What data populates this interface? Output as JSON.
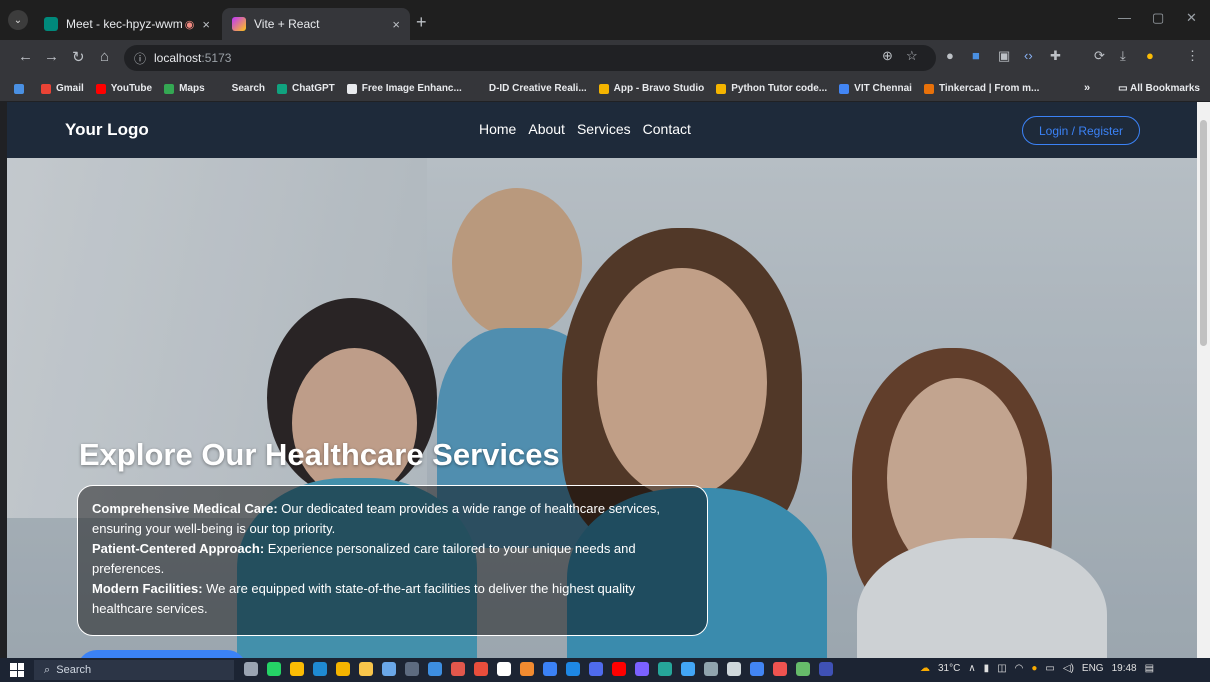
{
  "browser": {
    "tabs": [
      {
        "title": "Meet - kec-hpyz-wwm",
        "recording": "◉",
        "close": "×"
      },
      {
        "title": "Vite + React",
        "close": "×"
      }
    ],
    "new_tab": "+",
    "url_host": "localhost",
    "url_port": ":5173",
    "bookmarks": [
      {
        "label": "Gmail",
        "color": "#ea4335"
      },
      {
        "label": "YouTube",
        "color": "#ff0000"
      },
      {
        "label": "Maps",
        "color": "#34a853"
      },
      {
        "label": "Search",
        "color": "#35363a"
      },
      {
        "label": "ChatGPT",
        "color": "#10a37f"
      },
      {
        "label": "Free Image Enhanc...",
        "color": "#e8eaed"
      },
      {
        "label": "D-ID Creative Reali...",
        "color": "#35363a"
      },
      {
        "label": "App - Bravo Studio",
        "color": "#f4b400"
      },
      {
        "label": "Python Tutor code...",
        "color": "#f4b400"
      },
      {
        "label": "VIT Chennai",
        "color": "#4285f4"
      },
      {
        "label": "Tinkercad | From m...",
        "color": "#e8710a"
      }
    ],
    "bookmarks_more": "»",
    "all_bookmarks": "All Bookmarks"
  },
  "site": {
    "logo": "Your Logo",
    "nav": [
      "Home",
      "About",
      "Services",
      "Contact"
    ],
    "login_label": "Login / Register",
    "hero_title": "Explore Our Healthcare Services",
    "info": [
      {
        "heading": "Comprehensive Medical Care:",
        "text": " Our dedicated team provides a wide range of healthcare services, ensuring your well-being is our top priority."
      },
      {
        "heading": "Patient-Centered Approach:",
        "text": " Experience personalized care tailored to your unique needs and preferences."
      },
      {
        "heading": "Modern Facilities:",
        "text": " We are equipped with state-of-the-art facilities to deliver the highest quality healthcare services."
      }
    ],
    "accent_color": "#3b82f6",
    "navbar_color": "#1e2a3a"
  },
  "taskbar": {
    "search_placeholder": "Search",
    "temperature": "31°C",
    "language": "ENG",
    "time": "19:48"
  }
}
